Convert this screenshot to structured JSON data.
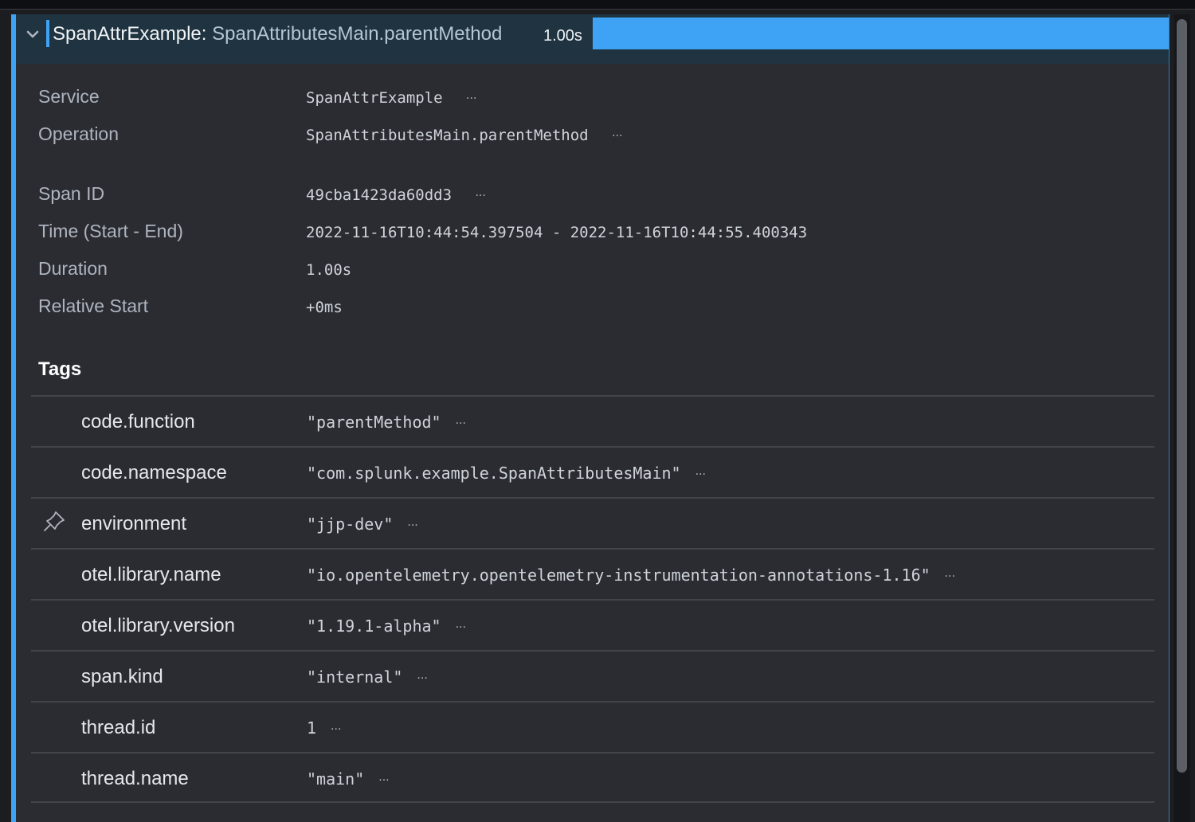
{
  "header": {
    "service": "SpanAttrExample:",
    "operation": "SpanAttributesMain.parentMethod",
    "duration": "1.00s",
    "accent_color": "#3ea2f5"
  },
  "details": [
    {
      "label": "Service",
      "value": "SpanAttrExample"
    },
    {
      "label": "Operation",
      "value": "SpanAttributesMain.parentMethod"
    },
    {
      "label": "Span ID",
      "value": "49cba1423da60dd3"
    },
    {
      "label": "Time (Start - End)",
      "value": "2022-11-16T10:44:54.397504 - 2022-11-16T10:44:55.400343"
    },
    {
      "label": "Duration",
      "value": "1.00s"
    },
    {
      "label": "Relative Start",
      "value": "+0ms"
    }
  ],
  "tags_title": "Tags",
  "tags": [
    {
      "key": "code.function",
      "value": "\"parentMethod\""
    },
    {
      "key": "code.namespace",
      "value": "\"com.splunk.example.SpanAttributesMain\""
    },
    {
      "key": "environment",
      "value": "\"jjp-dev\"",
      "icon": "pin-icon"
    },
    {
      "key": "otel.library.name",
      "value": "\"io.opentelemetry.opentelemetry-instrumentation-annotations-1.16\""
    },
    {
      "key": "otel.library.version",
      "value": "\"1.19.1-alpha\""
    },
    {
      "key": "span.kind",
      "value": "\"internal\""
    },
    {
      "key": "thread.id",
      "value": "1"
    },
    {
      "key": "thread.name",
      "value": "\"main\""
    }
  ],
  "more_glyph": "···"
}
